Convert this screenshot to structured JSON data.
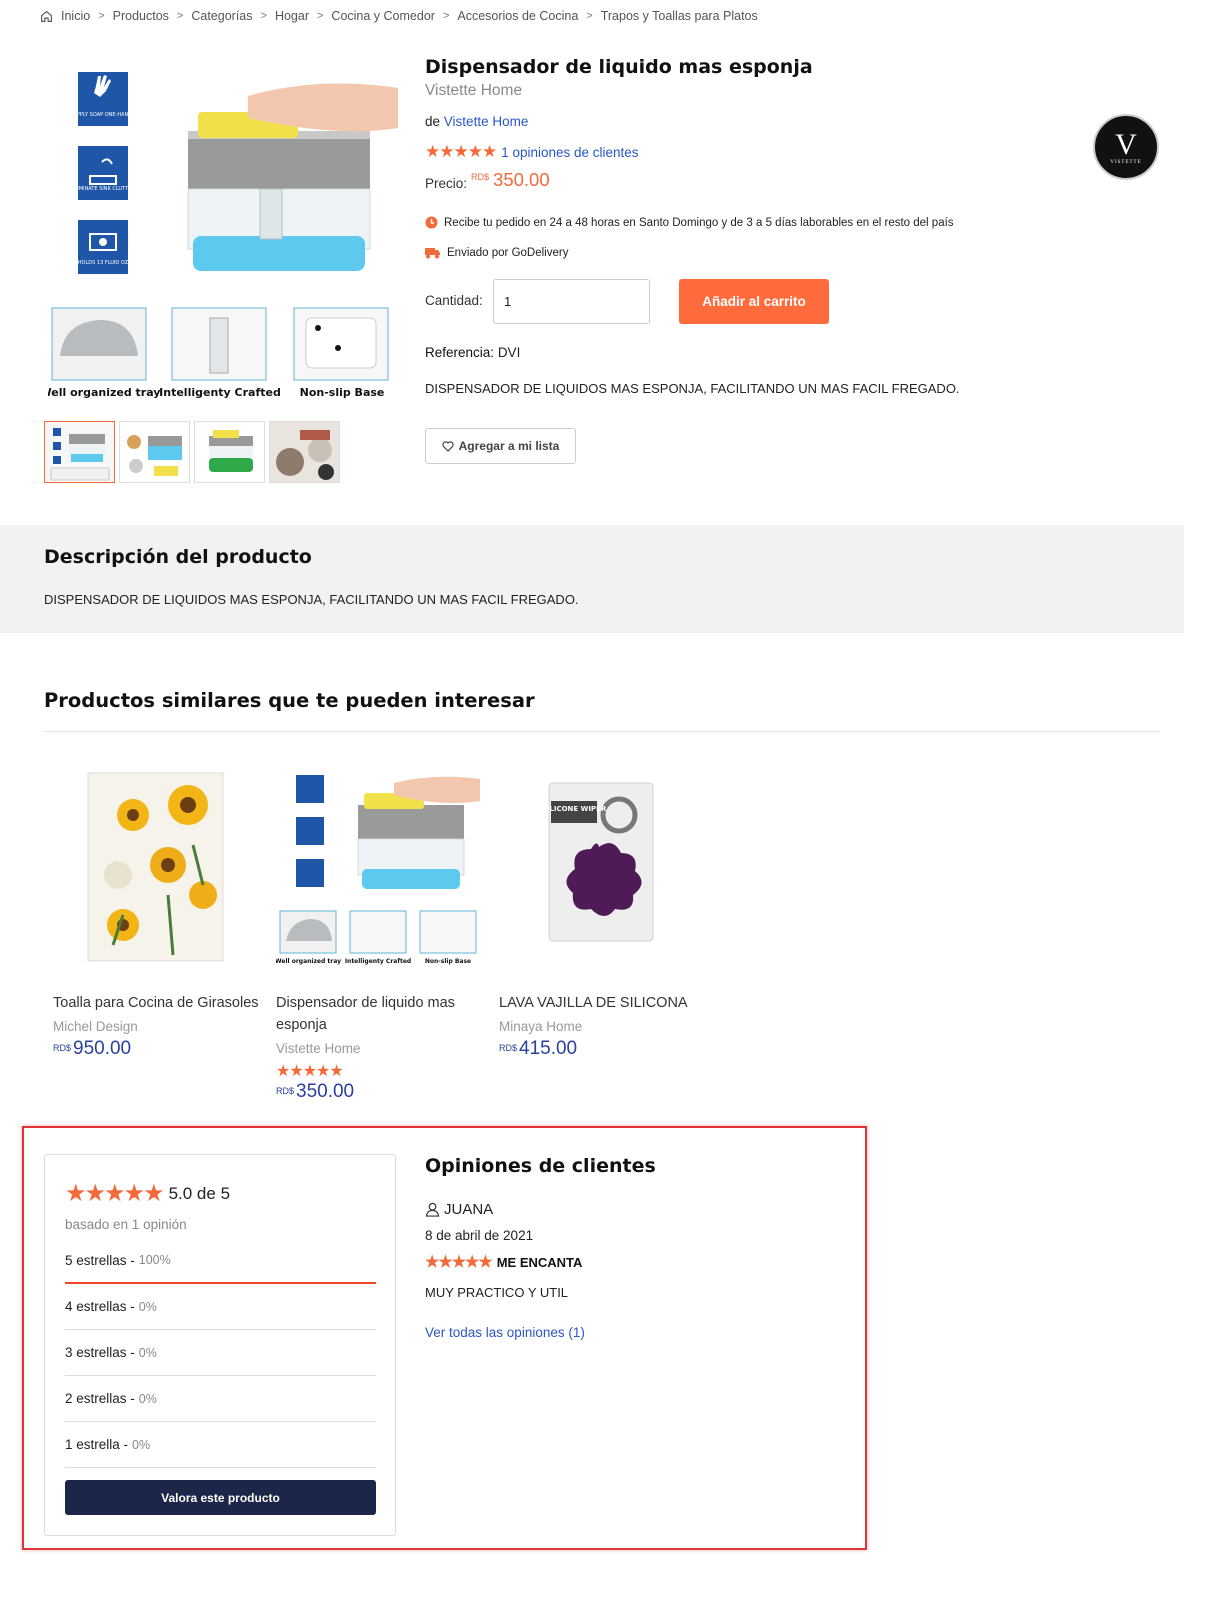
{
  "breadcrumb": [
    "Inicio",
    "Productos",
    "Categorías",
    "Hogar",
    "Cocina y Comedor",
    "Accesorios de Cocina",
    "Trapos y Toallas para Platos"
  ],
  "product": {
    "title": "Dispensador de liquido mas esponja",
    "subtitle": "Vistette Home",
    "by_prefix": "de",
    "seller": "Vistette Home",
    "stars": "★★★★★",
    "reviews_link": "1 opiniones de clientes",
    "price_label": "Precio:",
    "currency": "RD$",
    "price": "350.00",
    "delivery_info": "Recibe tu pedido en 24 a 48 horas en Santo Domingo y de 3 a 5 días laborables en el resto del país",
    "shipping_info": "Enviado por GoDelivery",
    "qty_label": "Cantidad:",
    "qty_value": "1",
    "add_to_cart": "Añadir al carrito",
    "ref_label": "Referencia:",
    "ref_value": "DVI",
    "short_desc": "DISPENSADOR DE LIQUIDOS MAS ESPONJA, FACILITANDO UN MAS FACIL FREGADO.",
    "wishlist": "Agregar a mi lista",
    "image_captions": [
      "Well organized tray",
      "Intelligenty Crafted",
      "Non-slip Base"
    ],
    "image_badges": [
      "REAPPLY SOAP ONE-HANDED",
      "ELIMINATE SINK CLUTTER",
      "HOLDS 13 FLUID OZ"
    ],
    "logo_letter": "V",
    "logo_text": "VISTETTE"
  },
  "description": {
    "heading": "Descripción del producto",
    "text": "DISPENSADOR DE LIQUIDOS MAS ESPONJA, FACILITANDO UN MAS FACIL FREGADO."
  },
  "similar": {
    "heading": "Productos similares que te pueden interesar",
    "items": [
      {
        "name": "Toalla para Cocina de Girasoles",
        "brand": "Michel Design",
        "stars": "",
        "currency": "RD$",
        "price": "950.00"
      },
      {
        "name": "Dispensador de liquido mas esponja",
        "brand": "Vistette Home",
        "stars": "★★★★★",
        "currency": "RD$",
        "price": "350.00"
      },
      {
        "name": "LAVA VAJILLA DE SILICONA",
        "brand": "Minaya Home",
        "stars": "",
        "currency": "RD$",
        "price": "415.00"
      }
    ],
    "wiper_label": "SILICONE WIPER"
  },
  "reviews_summary": {
    "stars": "★★★★★",
    "score": "5.0 de 5",
    "based_on": "basado en 1 opinión",
    "rows": [
      {
        "label": "5 estrellas -",
        "pct": "100%"
      },
      {
        "label": "4 estrellas -",
        "pct": "0%"
      },
      {
        "label": "3 estrellas -",
        "pct": "0%"
      },
      {
        "label": "2 estrellas -",
        "pct": "0%"
      },
      {
        "label": "1 estrella -",
        "pct": "0%"
      }
    ],
    "rate_button": "Valora este producto"
  },
  "reviews": {
    "heading": "Opiniones de clientes",
    "user": "JUANA",
    "date": "8 de abril de 2021",
    "stars": "★★★★★",
    "headline": "ME ENCANTA",
    "body": "MUY PRACTICO Y UTIL",
    "see_all": "Ver todas las opiniones (1)"
  },
  "colors": {
    "accent": "#ff6b3d",
    "link": "#2a56c6",
    "price_blue": "#2a3f9e",
    "dark_button": "#1c2648",
    "highlight": "#e0333a"
  }
}
